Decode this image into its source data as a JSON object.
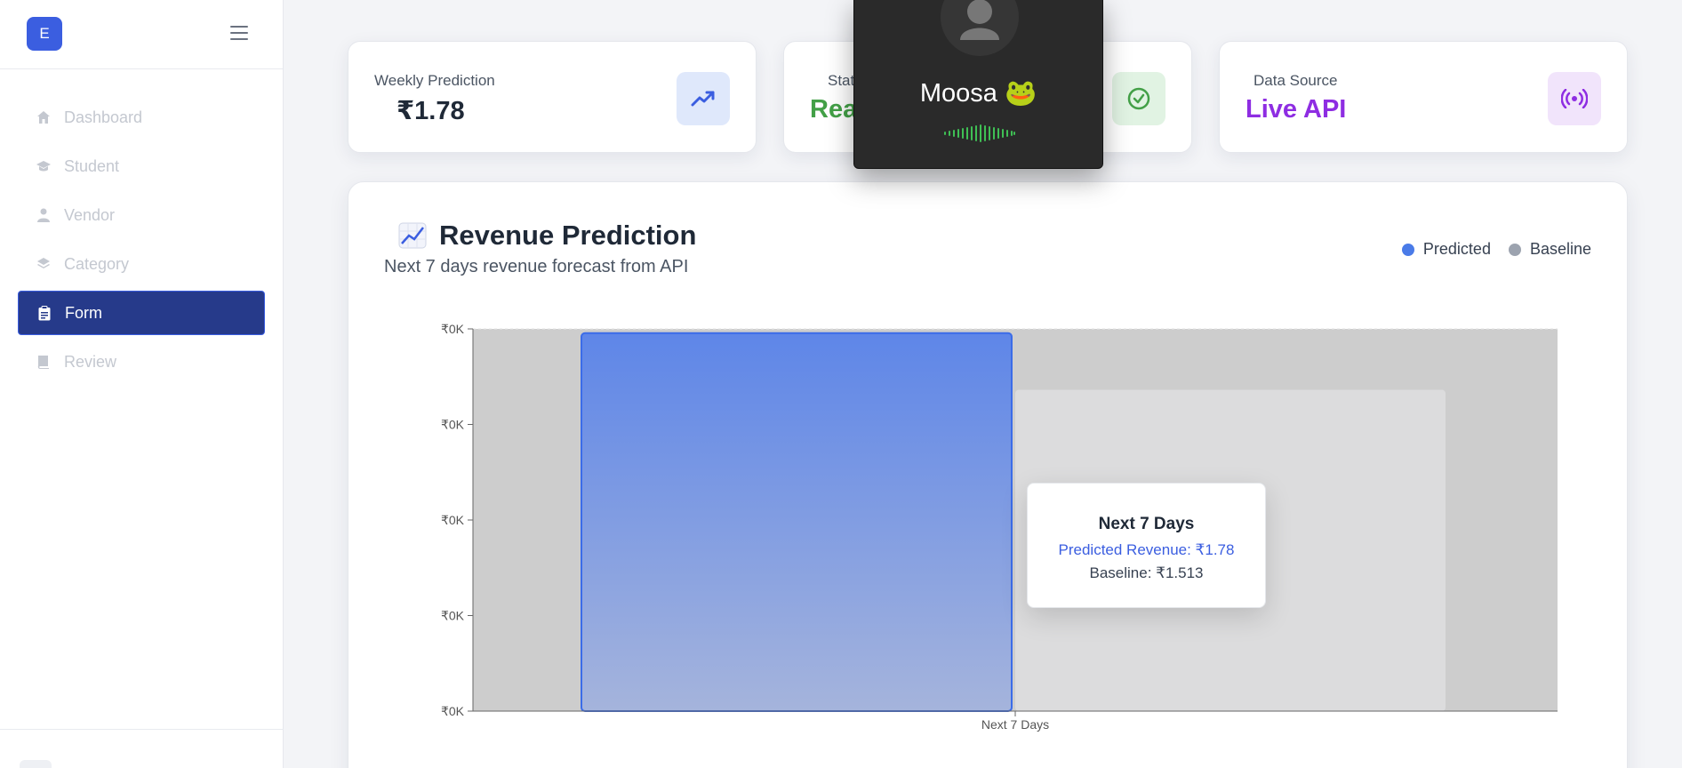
{
  "sidebar": {
    "logo_letter": "E",
    "items": [
      {
        "label": "Dashboard",
        "icon": "home-icon",
        "active": false
      },
      {
        "label": "Student",
        "icon": "graduation-cap-icon",
        "active": false
      },
      {
        "label": "Vendor",
        "icon": "user-icon",
        "active": false
      },
      {
        "label": "Category",
        "icon": "layers-icon",
        "active": false
      },
      {
        "label": "Form",
        "icon": "clipboard-icon",
        "active": true
      },
      {
        "label": "Review",
        "icon": "book-icon",
        "active": false
      }
    ]
  },
  "cards": {
    "weekly": {
      "label": "Weekly Prediction",
      "value": "₹1.78",
      "icon": "trending-up-icon"
    },
    "status": {
      "label": "Stat",
      "value": "Rea",
      "icon": "check-circle-icon",
      "color": "#43a047"
    },
    "source": {
      "label": "Data Source",
      "value": "Live API",
      "icon": "broadcast-icon",
      "color": "#8e2de2"
    }
  },
  "chart": {
    "title": "Revenue Prediction",
    "subtitle": "Next 7 days revenue forecast from API",
    "legend": [
      {
        "label": "Predicted",
        "color": "#4a7be8"
      },
      {
        "label": "Baseline",
        "color": "#9ca3af"
      }
    ]
  },
  "chart_data": {
    "type": "bar",
    "categories": [
      "Next 7 Days"
    ],
    "series": [
      {
        "name": "Predicted",
        "values": [
          1.78
        ]
      },
      {
        "name": "Baseline",
        "values": [
          1.513
        ]
      }
    ],
    "y_tick_labels": [
      "₹0K",
      "₹0K",
      "₹0K",
      "₹0K",
      "₹0K"
    ],
    "ylim": [
      0,
      1.8
    ],
    "grid": true
  },
  "tooltip": {
    "title": "Next 7 Days",
    "predicted": "Predicted Revenue: ₹1.78",
    "baseline": "Baseline: ₹1.513"
  },
  "call": {
    "name": "Moosa 🐸"
  }
}
